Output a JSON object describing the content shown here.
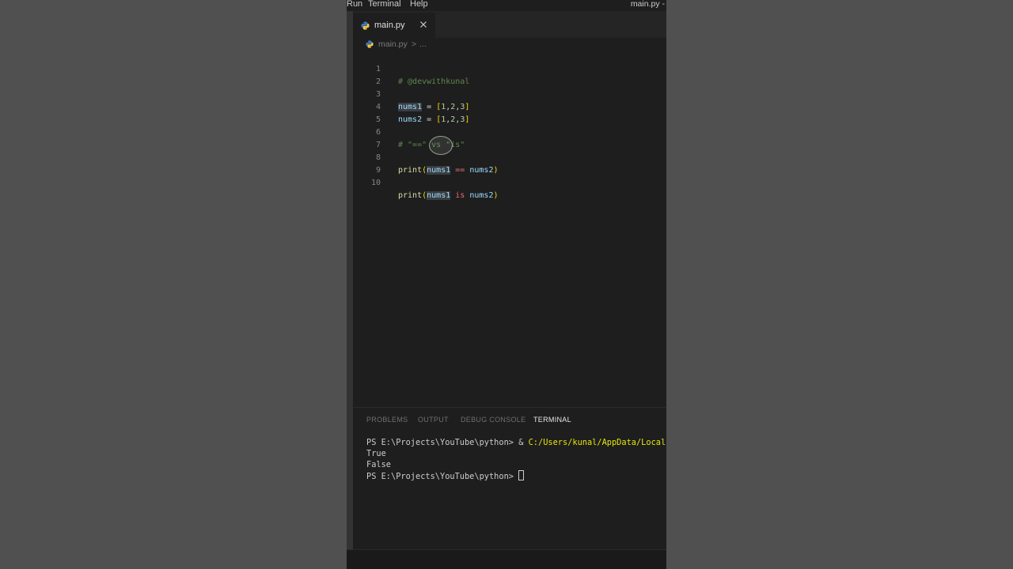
{
  "menubar": {
    "items": [
      "Run",
      "Terminal",
      "Help"
    ],
    "window_title": "main.py -"
  },
  "tabs": [
    {
      "label": "main.py",
      "icon": "python-icon",
      "active": true
    }
  ],
  "breadcrumb": {
    "file": "main.py",
    "separator": ">",
    "more": "..."
  },
  "editor": {
    "lines": [
      {
        "number": "1",
        "text": "# @devwithkunal"
      },
      {
        "number": "2",
        "text": ""
      },
      {
        "number": "3",
        "text": "nums1 = [1,2,3]"
      },
      {
        "number": "4",
        "text": "nums2 = [1,2,3]"
      },
      {
        "number": "5",
        "text": ""
      },
      {
        "number": "6",
        "text": "# \"==\" vs \"is\""
      },
      {
        "number": "7",
        "text": ""
      },
      {
        "number": "8",
        "text": "print(nums1 == nums2)"
      },
      {
        "number": "9",
        "text": ""
      },
      {
        "number": "10",
        "text": "print(nums1 is nums2)"
      }
    ]
  },
  "panel": {
    "tabs": [
      "PROBLEMS",
      "OUTPUT",
      "DEBUG CONSOLE",
      "TERMINAL"
    ],
    "active_tab": "TERMINAL"
  },
  "terminal": {
    "lines": [
      {
        "prompt": "PS E:\\Projects\\YouTube\\python> ",
        "op": "& ",
        "path": "C:/Users/kunal/AppData/Local"
      },
      {
        "text": "True"
      },
      {
        "text": "False"
      },
      {
        "prompt": "PS E:\\Projects\\YouTube\\python> "
      }
    ]
  },
  "colors": {
    "editor_bg": "#1e1e1e",
    "tab_bar_bg": "#252526",
    "comment": "#6a9955",
    "variable": "#9cdcfe",
    "bracket": "#ffd700",
    "number": "#b5cea8",
    "function": "#dcdcaa",
    "keyword": "#c586c0",
    "terminal_path": "#e5e510"
  }
}
